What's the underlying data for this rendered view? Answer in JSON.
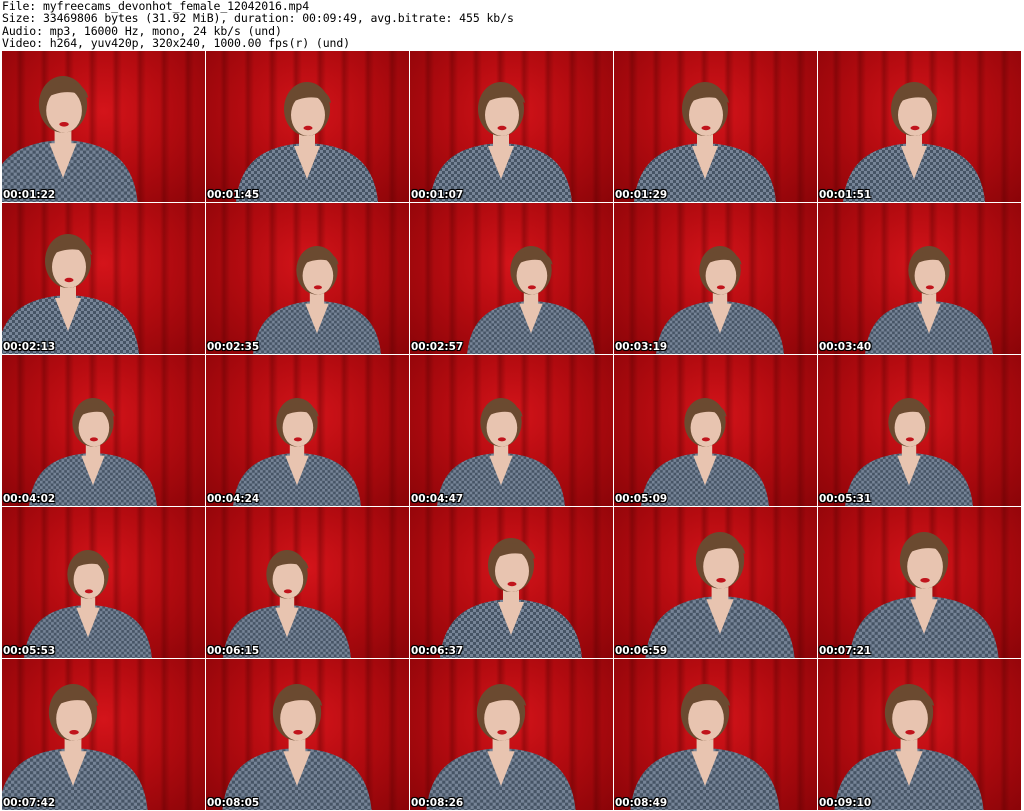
{
  "header": {
    "file": "File: myfreecams_devonhot_female_12042016.mp4",
    "size": "Size: 33469806 bytes (31.92 MiB), duration: 00:09:49, avg.bitrate: 455 kb/s",
    "audio": "Audio: mp3, 16000 Hz, mono, 24 kb/s (und)",
    "video": "Video: h264, yuv420p, 320x240, 1000.00 fps(r) (und)"
  },
  "thumbnails": [
    {
      "time": "00:01:22"
    },
    {
      "time": "00:01:45"
    },
    {
      "time": "00:01:07"
    },
    {
      "time": "00:01:29"
    },
    {
      "time": "00:01:51"
    },
    {
      "time": "00:02:13"
    },
    {
      "time": "00:02:35"
    },
    {
      "time": "00:02:57"
    },
    {
      "time": "00:03:19"
    },
    {
      "time": "00:03:40"
    },
    {
      "time": "00:04:02"
    },
    {
      "time": "00:04:24"
    },
    {
      "time": "00:04:47"
    },
    {
      "time": "00:05:09"
    },
    {
      "time": "00:05:31"
    },
    {
      "time": "00:05:53"
    },
    {
      "time": "00:06:15"
    },
    {
      "time": "00:06:37"
    },
    {
      "time": "00:06:59"
    },
    {
      "time": "00:07:21"
    },
    {
      "time": "00:07:42"
    },
    {
      "time": "00:08:05"
    },
    {
      "time": "00:08:26"
    },
    {
      "time": "00:08:49"
    },
    {
      "time": "00:09:10"
    }
  ],
  "colors": {
    "background": "#ffffff",
    "backdrop_red": "#c01016",
    "shirt": "#5d6c80",
    "hair": "#6b4a30",
    "skin": "#e8c4b0"
  }
}
